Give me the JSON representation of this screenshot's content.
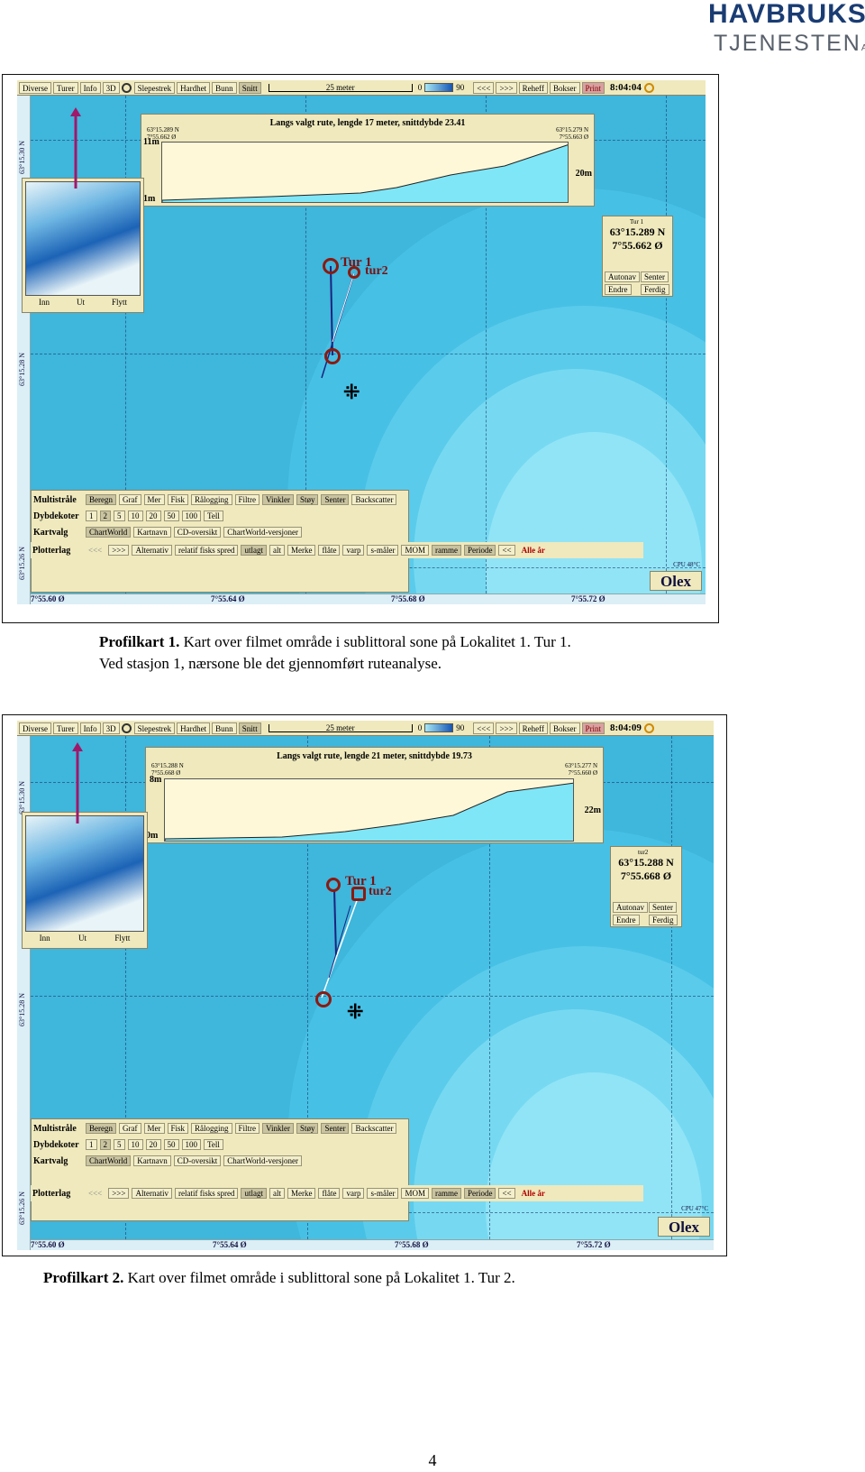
{
  "logo": {
    "line1": "HAVBRUKS",
    "line2": "TJENESTEN",
    "suffix": "AS"
  },
  "menu": [
    "Diverse",
    "Turer",
    "Info",
    "3D",
    "Slepestrek",
    "Hardhet",
    "Bunn",
    "Snitt"
  ],
  "toolbar": {
    "scale": "25 meter",
    "scale_min": "0",
    "scale_max": "90",
    "back": "<<<",
    "forward": ">>>",
    "reset": "Reheff",
    "bokser": "Bokser",
    "print": "Print"
  },
  "controls": {
    "multistraale": {
      "label": "Multistråle",
      "buttons": [
        "Beregn",
        "Graf",
        "Mer",
        "Fisk",
        "Rålogging",
        "Filtre",
        "Vinkler",
        "Støy",
        "Senter",
        "Backscatter"
      ]
    },
    "dybdekoter": {
      "label": "Dybdekoter",
      "buttons": [
        "1",
        "2",
        "5",
        "10",
        "20",
        "50",
        "100",
        "Tell"
      ]
    },
    "kartvalg": {
      "label": "Kartvalg",
      "buttons": [
        "ChartWorld",
        "Kartnavn",
        "CD-oversikt",
        "ChartWorld-versjoner"
      ]
    },
    "plotterlag": {
      "label": "Plotterlag",
      "buttons": [
        "<<<",
        ">>>",
        "Alternativ",
        "relatif fisks spred",
        "utlagt",
        "alt",
        "Merke",
        "flåte",
        "varp",
        "s-måler",
        "MOM",
        "ramme",
        "Periode",
        "<<",
        "Alle år"
      ]
    }
  },
  "inset_buttons": [
    "Inn",
    "Ut",
    "Flytt"
  ],
  "pos_buttons": [
    "Autonav",
    "Senter",
    "Endre",
    "Ferdig"
  ],
  "olex": "Olex",
  "latitudes": [
    "63°15.30 N",
    "63°15.28 N",
    "63°15.26 N"
  ],
  "longitudes": [
    "7°55.60 Ø",
    "7°55.64 Ø",
    "7°55.68 Ø",
    "7°55.72 Ø"
  ],
  "track_labels": [
    "Tur 1",
    "tur2"
  ],
  "figures": [
    {
      "clock": "8:04:04",
      "profile_title": "Langs valgt rute, lengde 17 meter, snittdybde 23.41",
      "start_coord": [
        "63°15.289 N",
        "7°55.662 Ø"
      ],
      "end_coord": [
        "63°15.279 N",
        "7°55.663 Ø"
      ],
      "depth_top": "11m",
      "depth_end": "20m",
      "depth_bottom": "1m",
      "pos_name": "Tur 1",
      "pos_lat": "63°15.289 N",
      "pos_lon": "7°55.662 Ø",
      "cpu": "CPU 48°C",
      "caption_bold": "Profilkart 1.",
      "caption_text": " Kart over filmet område i sublittoral sone på Lokalitet 1. Tur 1.",
      "caption_line2": "Ved stasjon 1, nærsone ble det gjennomført ruteanalyse."
    },
    {
      "clock": "8:04:09",
      "profile_title": "Langs valgt rute, lengde 21 meter, snittdybde 19.73",
      "start_coord": [
        "63°15.288 N",
        "7°55.668 Ø"
      ],
      "end_coord": [
        "63°15.277 N",
        "7°55.660 Ø"
      ],
      "depth_top": "8m",
      "depth_end": "22m",
      "depth_bottom": "0m",
      "pos_name": "tur2",
      "pos_lat": "63°15.288 N",
      "pos_lon": "7°55.668 Ø",
      "cpu": "CPU 47°C",
      "caption_bold": "Profilkart 2.",
      "caption_text": " Kart over filmet område i sublittoral sone på Lokalitet 1. Tur 2.",
      "caption_line2": ""
    }
  ],
  "page_number": "4",
  "colors": {
    "sea": "#3fb6dc",
    "panel": "#efe9bd",
    "track_red": "#8b1a10",
    "track_blue": "#1a237e",
    "pink": "#a0186a"
  }
}
